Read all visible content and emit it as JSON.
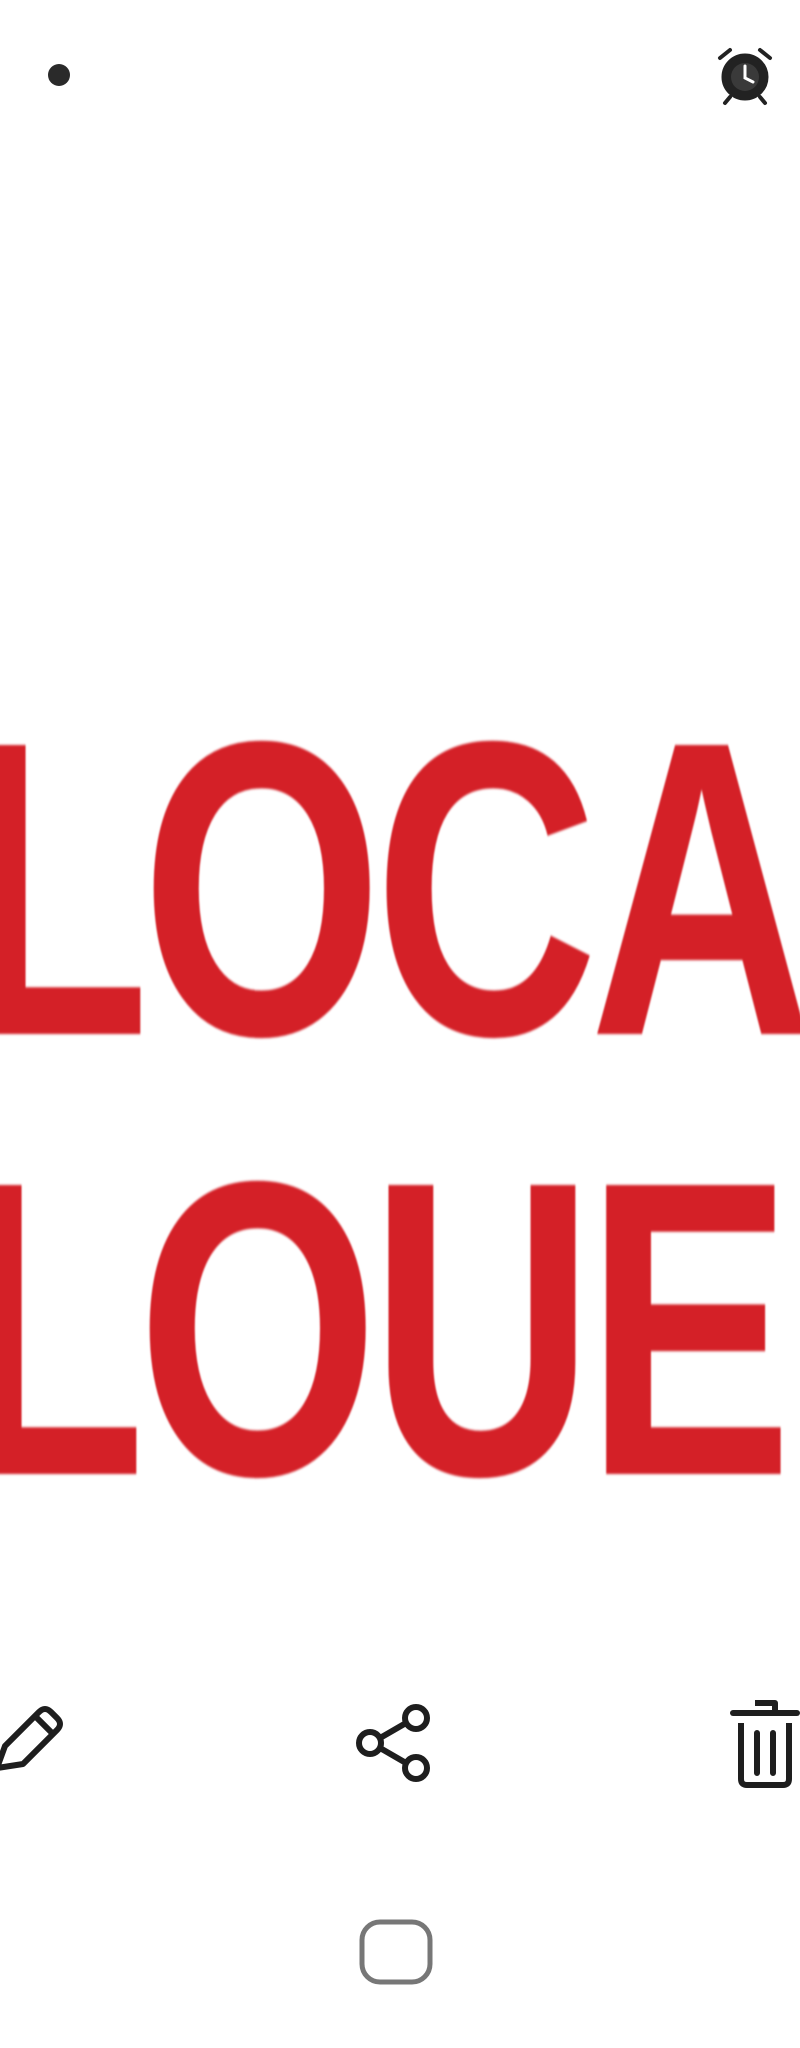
{
  "status_bar": {
    "left_indicator_icon": "notification-dot-icon",
    "right_icon": "alarm-clock-icon"
  },
  "image": {
    "sign_text_line1": "LOCAL",
    "sign_text_line2": "LOUE",
    "sign_color": "#d42027",
    "background_color": "#ffffff"
  },
  "toolbar": {
    "items": [
      {
        "name": "edit",
        "icon": "pencil-icon"
      },
      {
        "name": "share",
        "icon": "share-icon"
      },
      {
        "name": "delete",
        "icon": "trash-icon"
      }
    ]
  },
  "navigation": {
    "home_icon": "home-square-icon"
  }
}
